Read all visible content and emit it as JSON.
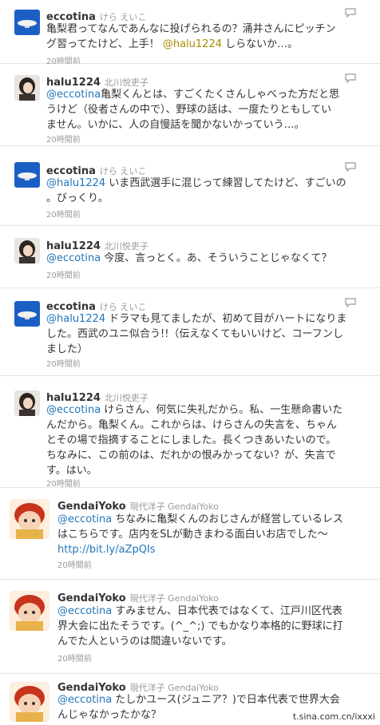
{
  "tweets": [
    {
      "username": "eccotina",
      "realname": "けら えいこ",
      "avatar_icon": "blimp-icon",
      "lines": [
        "亀梨君ってなんであんなに投げられるの？涌井さんにピッチン",
        "グ習ってたけど、上手！ "
      ],
      "mention_inline": "@halu1224",
      "line2_tail": " しらないか…。",
      "time": "20時間前"
    },
    {
      "username": "halu1224",
      "realname": "北川悦吏子",
      "avatar_icon": "woman-portrait-icon",
      "lines": [
        "亀梨くんとは、すごくたくさんしゃべった方だと思",
        "うけど（役者さんの中で）、野球の話は、一度たりともしてい",
        "ません。いかに、人の自慢話を聞かないかっていう…。"
      ],
      "mention": "@eccotina",
      "time": "20時間前"
    },
    {
      "username": "eccotina",
      "realname": "けら えいこ",
      "avatar_icon": "blimp-icon",
      "lines": [
        " いま西武選手に混じって練習してたけど、すごいの",
        "。びっくり。"
      ],
      "mention": "@halu1224",
      "time": "20時間前"
    },
    {
      "username": "halu1224",
      "realname": "北川悦吏子",
      "avatar_icon": "woman-portrait-icon",
      "lines": [
        " 今度、言っとく。あ、そういうことじゃなくて？"
      ],
      "mention": "@eccotina",
      "time": "20時間前"
    },
    {
      "username": "eccotina",
      "realname": "けら えいこ",
      "avatar_icon": "blimp-icon",
      "lines": [
        " ドラマも見てましたが、初めて目がハートになりま",
        "した。西武のユニ似合う!!（伝えなくてもいいけど、コーフンし",
        "ました）"
      ],
      "mention": "@halu1224",
      "time": "20時間前"
    },
    {
      "username": "halu1224",
      "realname": "北川悦吏子",
      "avatar_icon": "woman-portrait-icon",
      "lines": [
        " けらさん、何気に失礼だから。私、一生懸命書いた",
        "んだから。亀梨くん。これからは、けらさんの失言を、ちゃん",
        "とその場で指摘することにしました。長くつきあいたいので。",
        "ちなみに、この前のは、だれかの恨みかってない？が、失言で",
        "す。はい。"
      ],
      "mention": "@eccotina",
      "time": "20時間前"
    },
    {
      "username": "GendaiYoko",
      "realname": "現代洋子 GendaiYoko",
      "avatar_icon": "cartoon-girl-icon",
      "lines": [
        " ちなみに亀梨くんのおじさんが経営しているレス",
        "はこちらです。店内をSLが動きまわる面白いお店でした〜"
      ],
      "mention": "@eccotina",
      "link": "http://bit.ly/aZpQIs",
      "time": "20時間前"
    },
    {
      "username": "GendaiYoko",
      "realname": "現代洋子 GendaiYoko",
      "avatar_icon": "cartoon-girl-icon",
      "lines": [
        " すみません、日本代表ではなくて、江戸川区代表",
        "界大会に出たそうです。(^_^;) でもかなり本格的に野球に打",
        "んでた人というのは間違いないです。"
      ],
      "mention": "@eccotina",
      "time": "20時間前"
    },
    {
      "username": "GendaiYoko",
      "realname": "現代洋子 GendaiYoko",
      "avatar_icon": "cartoon-girl-icon",
      "lines": [
        " たしかユース(ジュニア？)で日本代表で世界大会",
        "んじゃなかったかな？"
      ],
      "mention": "@eccotina",
      "time": ""
    }
  ],
  "watermark": "t.sina.com.cn/ixxxi"
}
